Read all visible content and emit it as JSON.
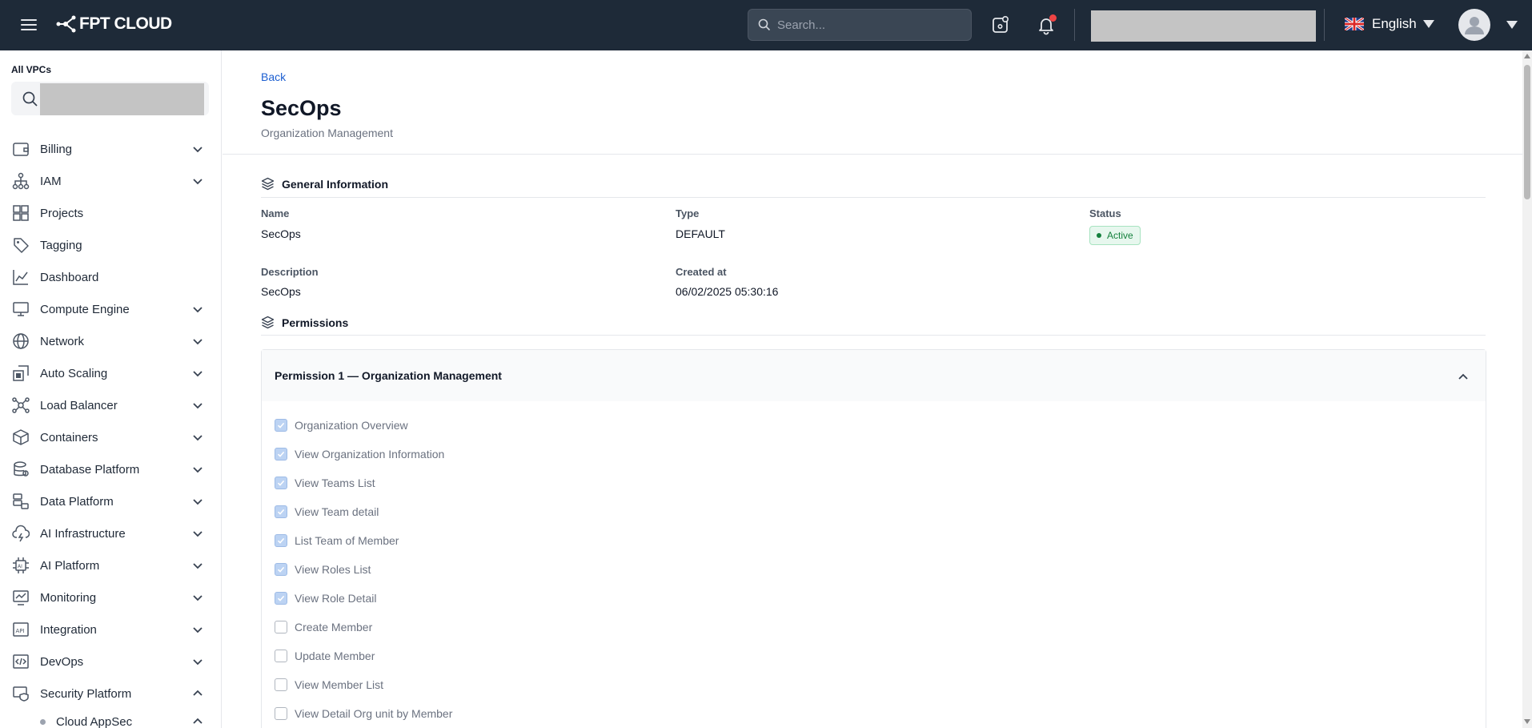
{
  "topbar": {
    "logo_text": "FPT CLOUD",
    "search_placeholder": "Search...",
    "language": "English",
    "notification_color": "#ef4444"
  },
  "sidebar": {
    "vpc_label": "All VPCs",
    "items": [
      {
        "label": "Billing",
        "icon": "wallet-icon",
        "expandable": true
      },
      {
        "label": "IAM",
        "icon": "hierarchy-icon",
        "expandable": true
      },
      {
        "label": "Projects",
        "icon": "grid-icon",
        "expandable": false
      },
      {
        "label": "Tagging",
        "icon": "tag-icon",
        "expandable": false
      },
      {
        "label": "Dashboard",
        "icon": "chart-icon",
        "expandable": false
      },
      {
        "label": "Compute Engine",
        "icon": "monitor-icon",
        "expandable": true
      },
      {
        "label": "Network",
        "icon": "globe-icon",
        "expandable": true
      },
      {
        "label": "Auto Scaling",
        "icon": "scaling-icon",
        "expandable": true
      },
      {
        "label": "Load Balancer",
        "icon": "nodes-icon",
        "expandable": true
      },
      {
        "label": "Containers",
        "icon": "box-icon",
        "expandable": true
      },
      {
        "label": "Database Platform",
        "icon": "database-icon",
        "expandable": true
      },
      {
        "label": "Data Platform",
        "icon": "data-icon",
        "expandable": true
      },
      {
        "label": "AI Infrastructure",
        "icon": "cloud-bolt-icon",
        "expandable": true
      },
      {
        "label": "AI Platform",
        "icon": "chip-icon",
        "expandable": true
      },
      {
        "label": "Monitoring",
        "icon": "monitor-chart-icon",
        "expandable": true
      },
      {
        "label": "Integration",
        "icon": "api-icon",
        "expandable": true
      },
      {
        "label": "DevOps",
        "icon": "code-icon",
        "expandable": true
      },
      {
        "label": "Security Platform",
        "icon": "shield-monitor-icon",
        "expandable": true,
        "expanded": true
      }
    ],
    "sub_items": [
      {
        "label": "Cloud AppSec"
      }
    ]
  },
  "main": {
    "back_label": "Back",
    "title": "SecOps",
    "subtitle": "Organization Management",
    "general": {
      "heading": "General Information",
      "name_label": "Name",
      "name_value": "SecOps",
      "type_label": "Type",
      "type_value": "DEFAULT",
      "status_label": "Status",
      "status_value": "Active",
      "description_label": "Description",
      "description_value": "SecOps",
      "created_label": "Created at",
      "created_value": "06/02/2025 05:30:16"
    },
    "permissions": {
      "heading": "Permissions",
      "group_title": "Permission 1 — Organization Management",
      "items": [
        {
          "label": "Organization Overview",
          "checked": true
        },
        {
          "label": "View Organization Information",
          "checked": true
        },
        {
          "label": "View Teams List",
          "checked": true
        },
        {
          "label": "View Team detail",
          "checked": true
        },
        {
          "label": "List Team of Member",
          "checked": true
        },
        {
          "label": "View Roles List",
          "checked": true
        },
        {
          "label": "View Role Detail",
          "checked": true
        },
        {
          "label": "Create Member",
          "checked": false
        },
        {
          "label": "Update Member",
          "checked": false
        },
        {
          "label": "View Member List",
          "checked": false
        },
        {
          "label": "View Detail Org unit by Member",
          "checked": false
        }
      ]
    }
  }
}
